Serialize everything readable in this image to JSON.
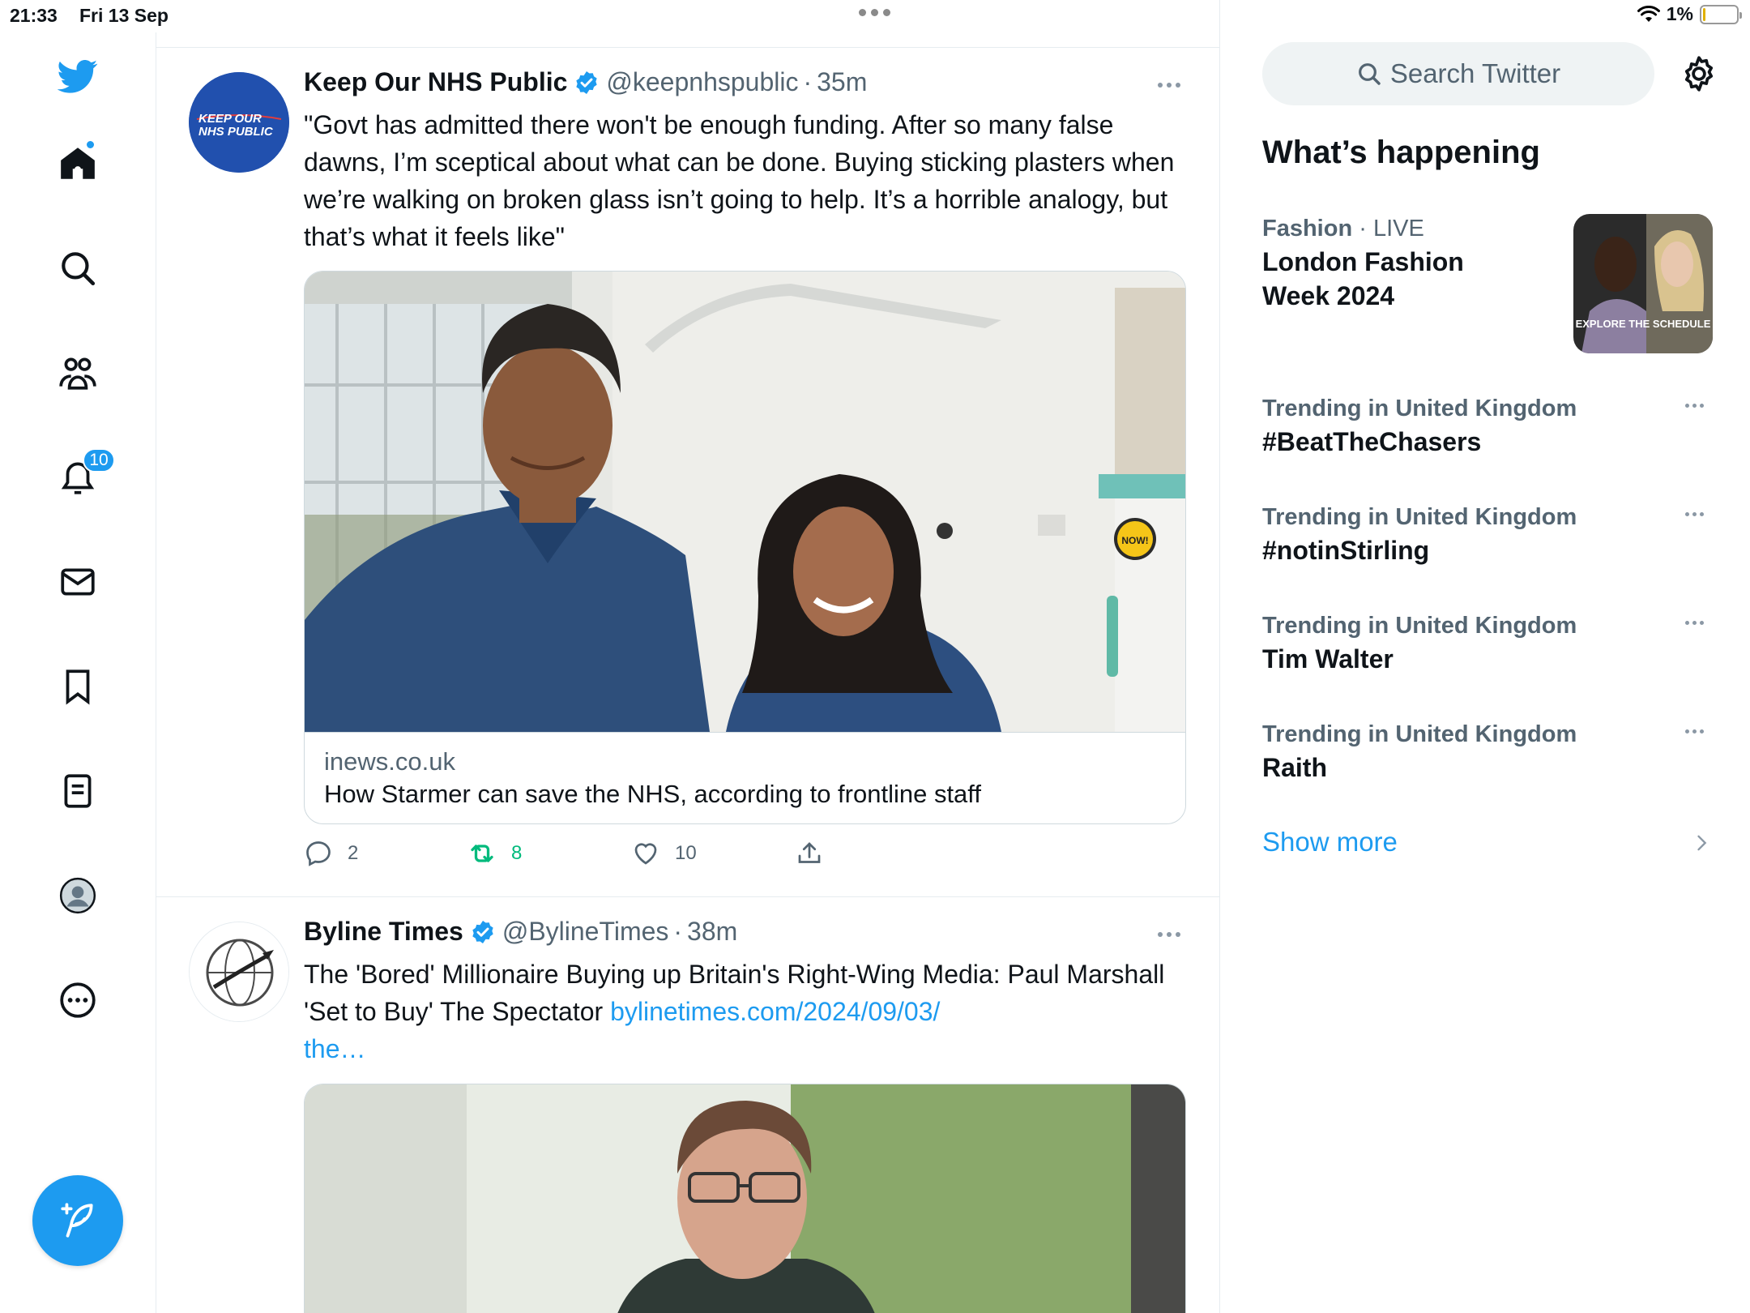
{
  "status_bar": {
    "time": "21:33",
    "date": "Fri 13 Sep",
    "battery": "1%"
  },
  "nav": {
    "notifications_badge": "10",
    "items": [
      "home",
      "explore",
      "communities",
      "notifications",
      "messages",
      "bookmarks",
      "lists",
      "profile",
      "more"
    ]
  },
  "tweets": [
    {
      "name": "Keep Our NHS Public",
      "handle": "@keepnhspublic",
      "time": "35m",
      "avatar_text": "KEEP OUR NHS PUBLIC",
      "text": "\"Govt has admitted there won't be enough funding. After so many false dawns, I’m sceptical about what can be done. Buying sticking plasters when we’re walking on broken glass isn’t going to help. It’s a horrible analogy, but that’s what it feels like\"",
      "card": {
        "domain": "inews.co.uk",
        "title": "How Starmer can save the NHS, according to frontline staff",
        "sign_text": "NOW!"
      },
      "actions": {
        "replies": "2",
        "retweets": "8",
        "likes": "10"
      }
    },
    {
      "name": "Byline Times",
      "handle": "@BylineTimes",
      "time": "38m",
      "text": "The 'Bored' Millionaire Buying up Britain's Right-Wing Media: Paul Marshall 'Set to Buy' The Spectator ",
      "link": "bylinetimes.com/2024/09/03/",
      "link2": "the…"
    }
  ],
  "sidebar": {
    "search_placeholder": "Search Twitter",
    "title": "What’s happening",
    "featured": {
      "category": "Fashion",
      "status": "LIVE",
      "name": "London Fashion Week 2024",
      "image_text": "EXPLORE THE SCHEDULE"
    },
    "trends": [
      {
        "context": "Trending in United Kingdom",
        "name": "#BeatTheChasers"
      },
      {
        "context": "Trending in United Kingdom",
        "name": "#notinStirling"
      },
      {
        "context": "Trending in United Kingdom",
        "name": "Tim Walter"
      },
      {
        "context": "Trending in United Kingdom",
        "name": "Raith"
      }
    ],
    "show_more": "Show more"
  },
  "colors": {
    "accent": "#1d9bf0",
    "retweet_green": "#00ba7c",
    "secondary_text": "#536471"
  }
}
